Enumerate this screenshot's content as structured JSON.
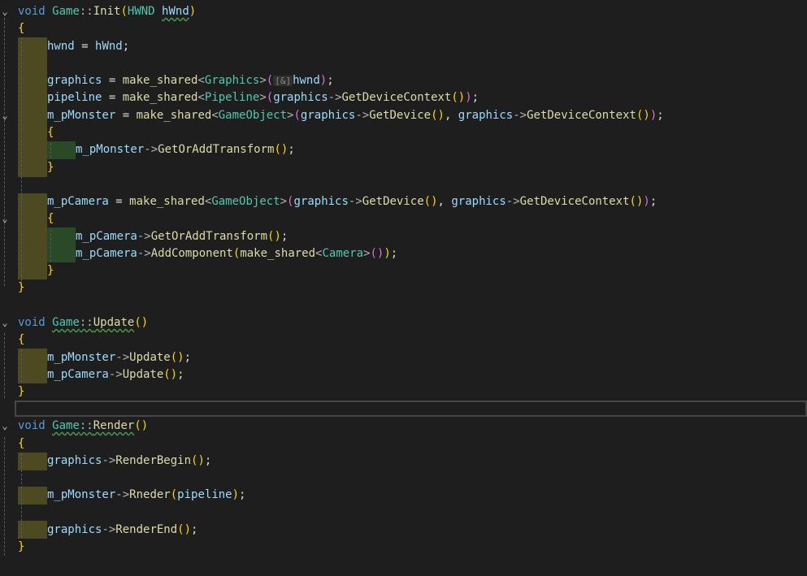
{
  "editor": {
    "language": "C++",
    "colors": {
      "background": "#1e1e1e",
      "keyword": "#569cd6",
      "type": "#4ec9b0",
      "function": "#dcdcaa",
      "variable": "#9cdcfe",
      "brace": "#ffd700",
      "scope_highlight": "#4d4a21",
      "nested_scope_highlight": "#2a4a27"
    },
    "lines": [
      {
        "fold": "expanded",
        "tokens": [
          [
            "void ",
            "kw"
          ],
          [
            "Game",
            "type"
          ],
          [
            "::",
            "punct"
          ],
          [
            "Init",
            "fn"
          ],
          [
            "(",
            "brace"
          ],
          [
            "HWND ",
            "type"
          ],
          [
            "hWnd",
            "var squig"
          ],
          [
            ")",
            "brace"
          ]
        ]
      },
      {
        "tokens": [
          [
            "{",
            "brace"
          ]
        ]
      },
      {
        "tokens": [
          [
            "hwnd",
            "var"
          ],
          [
            " = ",
            "plain"
          ],
          [
            "hWnd",
            "var"
          ],
          [
            ";",
            "plain"
          ]
        ]
      },
      {
        "tokens": []
      },
      {
        "tokens": [
          [
            "graphics",
            "var"
          ],
          [
            " = ",
            "plain"
          ],
          [
            "make_shared",
            "fn"
          ],
          [
            "<",
            "punct"
          ],
          [
            "Graphics",
            "type"
          ],
          [
            ">",
            "punct"
          ],
          [
            "(",
            "paren2"
          ],
          [
            "[&]",
            "hint"
          ],
          [
            "hwnd",
            "var"
          ],
          [
            ")",
            "paren2"
          ],
          [
            ";",
            "plain"
          ]
        ]
      },
      {
        "tokens": [
          [
            "pipeline",
            "var"
          ],
          [
            " = ",
            "plain"
          ],
          [
            "make_shared",
            "fn"
          ],
          [
            "<",
            "punct"
          ],
          [
            "Pipeline",
            "type"
          ],
          [
            ">",
            "punct"
          ],
          [
            "(",
            "paren2"
          ],
          [
            "graphics",
            "var"
          ],
          [
            "->",
            "punct"
          ],
          [
            "GetDeviceContext",
            "fn"
          ],
          [
            "()",
            "brace"
          ],
          [
            ")",
            "paren2"
          ],
          [
            ";",
            "plain"
          ]
        ]
      },
      {
        "fold": "expanded",
        "tokens": [
          [
            "m_pMonster",
            "var"
          ],
          [
            " = ",
            "plain"
          ],
          [
            "make_shared",
            "fn"
          ],
          [
            "<",
            "punct"
          ],
          [
            "GameObject",
            "type"
          ],
          [
            ">",
            "punct"
          ],
          [
            "(",
            "paren2"
          ],
          [
            "graphics",
            "var"
          ],
          [
            "->",
            "punct"
          ],
          [
            "GetDevice",
            "fn"
          ],
          [
            "()",
            "brace"
          ],
          [
            ", ",
            "plain"
          ],
          [
            "graphics",
            "var"
          ],
          [
            "->",
            "punct"
          ],
          [
            "GetDeviceContext",
            "fn"
          ],
          [
            "()",
            "brace"
          ],
          [
            ")",
            "paren2"
          ],
          [
            ";",
            "plain"
          ]
        ]
      },
      {
        "tokens": [
          [
            "{",
            "brace"
          ]
        ]
      },
      {
        "tokens": [
          [
            "m_pMonster",
            "var"
          ],
          [
            "->",
            "punct"
          ],
          [
            "GetOrAddTransform",
            "fn"
          ],
          [
            "()",
            "brace"
          ],
          [
            ";",
            "plain"
          ]
        ]
      },
      {
        "tokens": [
          [
            "}",
            "brace"
          ]
        ]
      },
      {
        "tokens": []
      },
      {
        "tokens": [
          [
            "m_pCamera",
            "var"
          ],
          [
            " = ",
            "plain"
          ],
          [
            "make_shared",
            "fn"
          ],
          [
            "<",
            "punct"
          ],
          [
            "GameObject",
            "type"
          ],
          [
            ">",
            "punct"
          ],
          [
            "(",
            "paren2"
          ],
          [
            "graphics",
            "var"
          ],
          [
            "->",
            "punct"
          ],
          [
            "GetDevice",
            "fn"
          ],
          [
            "()",
            "brace"
          ],
          [
            ", ",
            "plain"
          ],
          [
            "graphics",
            "var"
          ],
          [
            "->",
            "punct"
          ],
          [
            "GetDeviceContext",
            "fn"
          ],
          [
            "()",
            "brace"
          ],
          [
            ")",
            "paren2"
          ],
          [
            ";",
            "plain"
          ]
        ]
      },
      {
        "fold": "expanded",
        "tokens": [
          [
            "{",
            "brace"
          ]
        ]
      },
      {
        "tokens": [
          [
            "m_pCamera",
            "var"
          ],
          [
            "->",
            "punct"
          ],
          [
            "GetOrAddTransform",
            "fn"
          ],
          [
            "()",
            "brace"
          ],
          [
            ";",
            "plain"
          ]
        ]
      },
      {
        "tokens": [
          [
            "m_pCamera",
            "var"
          ],
          [
            "->",
            "punct"
          ],
          [
            "AddComponent",
            "fn"
          ],
          [
            "(",
            "brace"
          ],
          [
            "make_shared",
            "fn"
          ],
          [
            "<",
            "punct"
          ],
          [
            "Camera",
            "type"
          ],
          [
            ">",
            "punct"
          ],
          [
            "()",
            "paren2"
          ],
          [
            ")",
            "brace"
          ],
          [
            ";",
            "plain"
          ]
        ]
      },
      {
        "tokens": [
          [
            "}",
            "brace"
          ]
        ]
      },
      {
        "tokens": [
          [
            "}",
            "brace"
          ]
        ]
      },
      {
        "tokens": []
      },
      {
        "fold": "expanded",
        "tokens": [
          [
            "void ",
            "kw"
          ],
          [
            "Game",
            "type squig"
          ],
          [
            "::",
            "punct squig"
          ],
          [
            "Update",
            "fn squig"
          ],
          [
            "()",
            "brace"
          ]
        ]
      },
      {
        "tokens": [
          [
            "{",
            "brace"
          ]
        ]
      },
      {
        "tokens": [
          [
            "m_pMonster",
            "var"
          ],
          [
            "->",
            "punct"
          ],
          [
            "Update",
            "fn"
          ],
          [
            "()",
            "brace"
          ],
          [
            ";",
            "plain"
          ]
        ]
      },
      {
        "tokens": [
          [
            "m_pCamera",
            "var"
          ],
          [
            "->",
            "punct"
          ],
          [
            "Update",
            "fn"
          ],
          [
            "()",
            "brace"
          ],
          [
            ";",
            "plain"
          ]
        ]
      },
      {
        "tokens": [
          [
            "}",
            "brace"
          ]
        ]
      },
      {
        "current": true,
        "tokens": []
      },
      {
        "fold": "expanded",
        "tokens": [
          [
            "void ",
            "kw"
          ],
          [
            "Game",
            "type squig"
          ],
          [
            "::",
            "punct squig"
          ],
          [
            "Render",
            "fn squig"
          ],
          [
            "()",
            "brace"
          ]
        ]
      },
      {
        "tokens": [
          [
            "{",
            "brace"
          ]
        ]
      },
      {
        "tokens": [
          [
            "graphics",
            "var"
          ],
          [
            "->",
            "punct"
          ],
          [
            "RenderBegin",
            "fn"
          ],
          [
            "()",
            "brace"
          ],
          [
            ";",
            "plain"
          ]
        ]
      },
      {
        "tokens": []
      },
      {
        "tokens": [
          [
            "m_pMonster",
            "var"
          ],
          [
            "->",
            "punct"
          ],
          [
            "Rneder",
            "fn"
          ],
          [
            "(",
            "brace"
          ],
          [
            "pipeline",
            "var"
          ],
          [
            ")",
            "brace"
          ],
          [
            ";",
            "plain"
          ]
        ]
      },
      {
        "tokens": []
      },
      {
        "tokens": [
          [
            "graphics",
            "var"
          ],
          [
            "->",
            "punct"
          ],
          [
            "RenderEnd",
            "fn"
          ],
          [
            "()",
            "brace"
          ],
          [
            ";",
            "plain"
          ]
        ]
      },
      {
        "tokens": [
          [
            "}",
            "brace"
          ]
        ]
      }
    ]
  }
}
